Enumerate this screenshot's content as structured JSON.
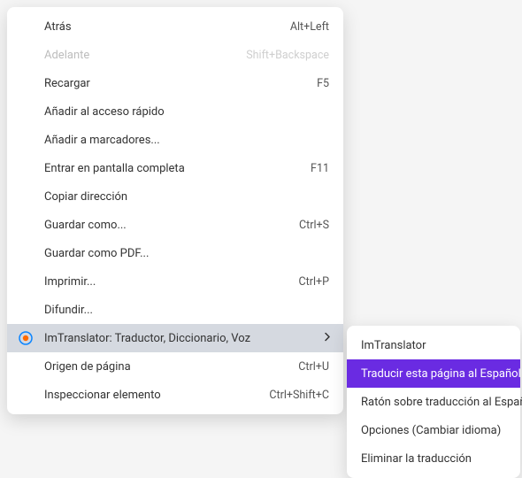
{
  "menu": {
    "items": [
      {
        "label": "Atrás",
        "shortcut": "Alt+Left",
        "disabled": false
      },
      {
        "label": "Adelante",
        "shortcut": "Shift+Backspace",
        "disabled": true
      },
      {
        "label": "Recargar",
        "shortcut": "F5"
      },
      {
        "label": "Añadir al acceso rápido",
        "shortcut": ""
      },
      {
        "label": "Añadir a marcadores...",
        "shortcut": ""
      },
      {
        "label": "Entrar en pantalla completa",
        "shortcut": "F11"
      },
      {
        "label": "Copiar dirección",
        "shortcut": ""
      },
      {
        "label": "Guardar como...",
        "shortcut": "Ctrl+S"
      },
      {
        "label": "Guardar como PDF...",
        "shortcut": ""
      },
      {
        "label": "Imprimir...",
        "shortcut": "Ctrl+P"
      },
      {
        "label": "Difundir...",
        "shortcut": ""
      },
      {
        "label": "ImTranslator: Traductor, Diccionario, Voz",
        "shortcut": "",
        "submenu": true,
        "icon": "imtranslator-icon"
      },
      {
        "label": "Origen de página",
        "shortcut": "Ctrl+U"
      },
      {
        "label": "Inspeccionar elemento",
        "shortcut": "Ctrl+Shift+C"
      }
    ]
  },
  "submenu": {
    "items": [
      {
        "label": "ImTranslator"
      },
      {
        "label": "Traducir esta página al Español",
        "selected": true
      },
      {
        "label": "Ratón sobre traducción al Español"
      },
      {
        "label": "Opciones (Cambiar idioma)"
      },
      {
        "label": "Eliminar la traducción"
      }
    ]
  }
}
